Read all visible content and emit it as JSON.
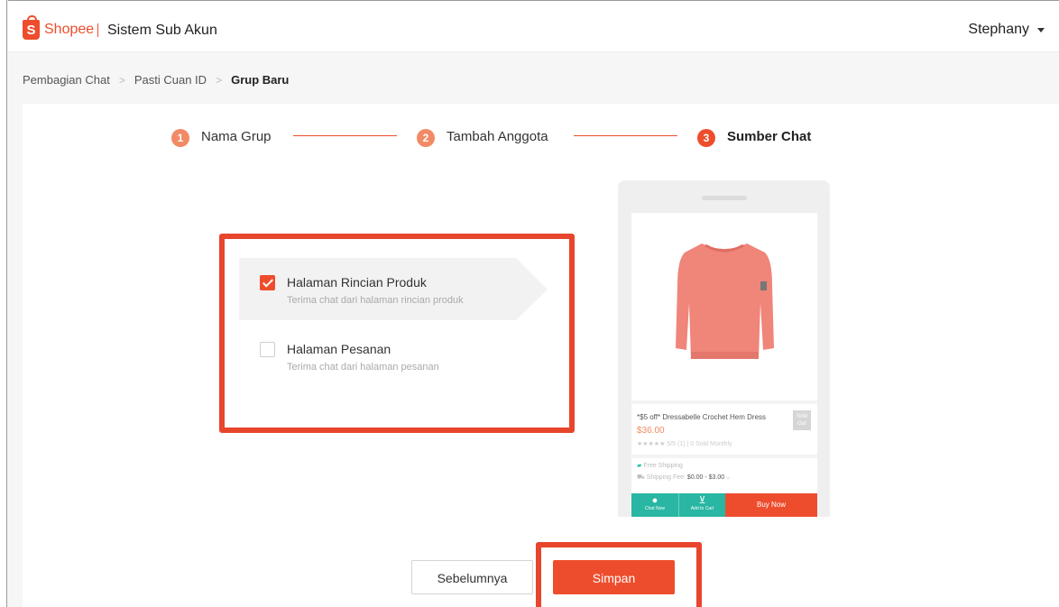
{
  "header": {
    "logo_letter": "S",
    "logo_text": "Shopee",
    "app_title": "Sistem Sub Akun",
    "user_name": "Stephany"
  },
  "breadcrumb": [
    "Pembagian Chat",
    "Pasti Cuan ID",
    "Grup Baru"
  ],
  "steps": [
    {
      "num": "1",
      "label": "Nama Grup"
    },
    {
      "num": "2",
      "label": "Tambah Anggota"
    },
    {
      "num": "3",
      "label": "Sumber Chat"
    }
  ],
  "options": [
    {
      "title": "Halaman Rincian Produk",
      "subtitle": "Terima chat dari halaman rincian produk",
      "checked": true
    },
    {
      "title": "Halaman Pesanan",
      "subtitle": "Terima chat dari halaman pesanan",
      "checked": false
    }
  ],
  "preview": {
    "product_name": "*$5 off* Dressabelle Crochet Hem Dress",
    "price": "$36.00",
    "rating": "★★★★★ 5/5 (1) | 0 Sold Monthly",
    "sold_out": "Sold Out",
    "free_shipping": "Free Shipping",
    "shipping_fee_label": "Shipping Fee:",
    "shipping_fee_value": "$0.00 - $3.00",
    "chat_label": "Chat Now",
    "cart_label": "Add to Cart",
    "buy_label": "Buy Now"
  },
  "buttons": {
    "prev": "Sebelumnya",
    "save": "Simpan"
  },
  "colors": {
    "brand": "#ee4d2d",
    "step_done": "#f28a66",
    "highlight": "#e8452d"
  }
}
